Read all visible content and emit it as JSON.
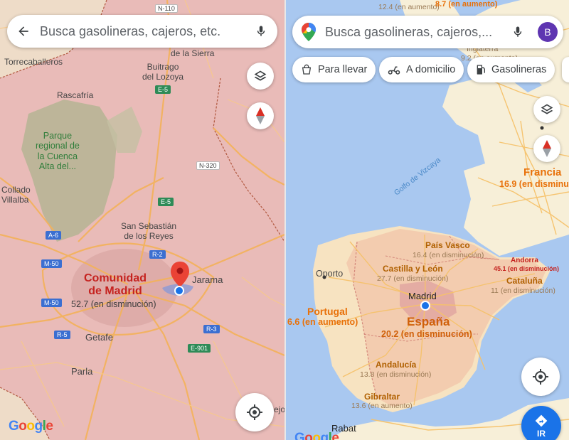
{
  "colors": {
    "comunidad_fill": "#e8b4b3",
    "spain_highlight": "#f2c4a8",
    "land": "#f7efd8",
    "water": "#a9c8f0",
    "accent_blue": "#1a73e8",
    "pin_red": "#ea4335",
    "road_orange": "#f6b25a"
  },
  "left": {
    "search": {
      "placeholder": "Busca gasolineras, cajeros, etc."
    },
    "icons": {
      "back": "arrow-left-icon",
      "mic": "microphone-icon",
      "layers": "layers-icon",
      "compass": "compass-icon",
      "locate": "my-location-icon"
    },
    "roads": [
      "N-110",
      "E-5",
      "N-320",
      "E-5",
      "A-6",
      "M-50",
      "R-2",
      "M-50",
      "R-5",
      "R-3",
      "E-901"
    ],
    "places": [
      {
        "name": "Torrecaballeros"
      },
      {
        "name": "Buitrago\ndel Lozoya"
      },
      {
        "name": "de la Sierra"
      },
      {
        "name": "Rascafría"
      },
      {
        "name": "Collado\nVillalba"
      },
      {
        "name": "San Sebastián\nde los Reyes"
      },
      {
        "name": "Jarama"
      },
      {
        "name": "Getafe"
      },
      {
        "name": "Parla"
      },
      {
        "name": "ejo"
      }
    ],
    "park": "Parque\nregional de\nla Cuenca\nAlta del...",
    "region_name": "Comunidad\nde Madrid",
    "region_stat": "52.7 (en disminución)",
    "logo": "Google"
  },
  "right": {
    "search": {
      "placeholder": "Busca gasolineras, cajeros,..."
    },
    "avatar_letter": "B",
    "icons": {
      "maps_logo": "google-maps-pin-icon",
      "mic": "microphone-icon",
      "layers": "layers-icon",
      "compass": "compass-icon",
      "locate": "my-location-icon",
      "directions": "directions-icon"
    },
    "chips": [
      {
        "label": "Para llevar",
        "icon": "takeout-bag-icon"
      },
      {
        "label": "A domicilio",
        "icon": "delivery-scooter-icon"
      },
      {
        "label": "Gasolineras",
        "icon": "gas-pump-icon"
      }
    ],
    "top_stats": [
      "12.4 (en aumento)",
      "8.7 (en aumento)"
    ],
    "top_places": [
      "Inglaterra",
      "9.2 (en aumento)"
    ],
    "sea_label": "Golfo de Vizcaya",
    "countries": [
      {
        "name": "Francia",
        "stat": "16.9 (en disminuc"
      },
      {
        "name": "Portugal",
        "stat": "6.6 (en aumento)"
      },
      {
        "name": "España",
        "stat": "20.2 (en disminución)"
      },
      {
        "name": "Andorra",
        "stat": "45.1 (en disminución)"
      }
    ],
    "regions": [
      {
        "name": "País Vasco",
        "stat": "16.4 (en disminución)"
      },
      {
        "name": "Castilla y León",
        "stat": "27.7 (en disminución)"
      },
      {
        "name": "Cataluña",
        "stat": "11 (en disminución)"
      },
      {
        "name": "Andalucía",
        "stat": "13.8 (en disminución)"
      },
      {
        "name": "Gibraltar",
        "stat": "13.6 (en aumento)"
      }
    ],
    "cities": [
      "Oporto",
      "Madrid",
      "Rabat"
    ],
    "go_button": "IR",
    "logo": "Google"
  }
}
